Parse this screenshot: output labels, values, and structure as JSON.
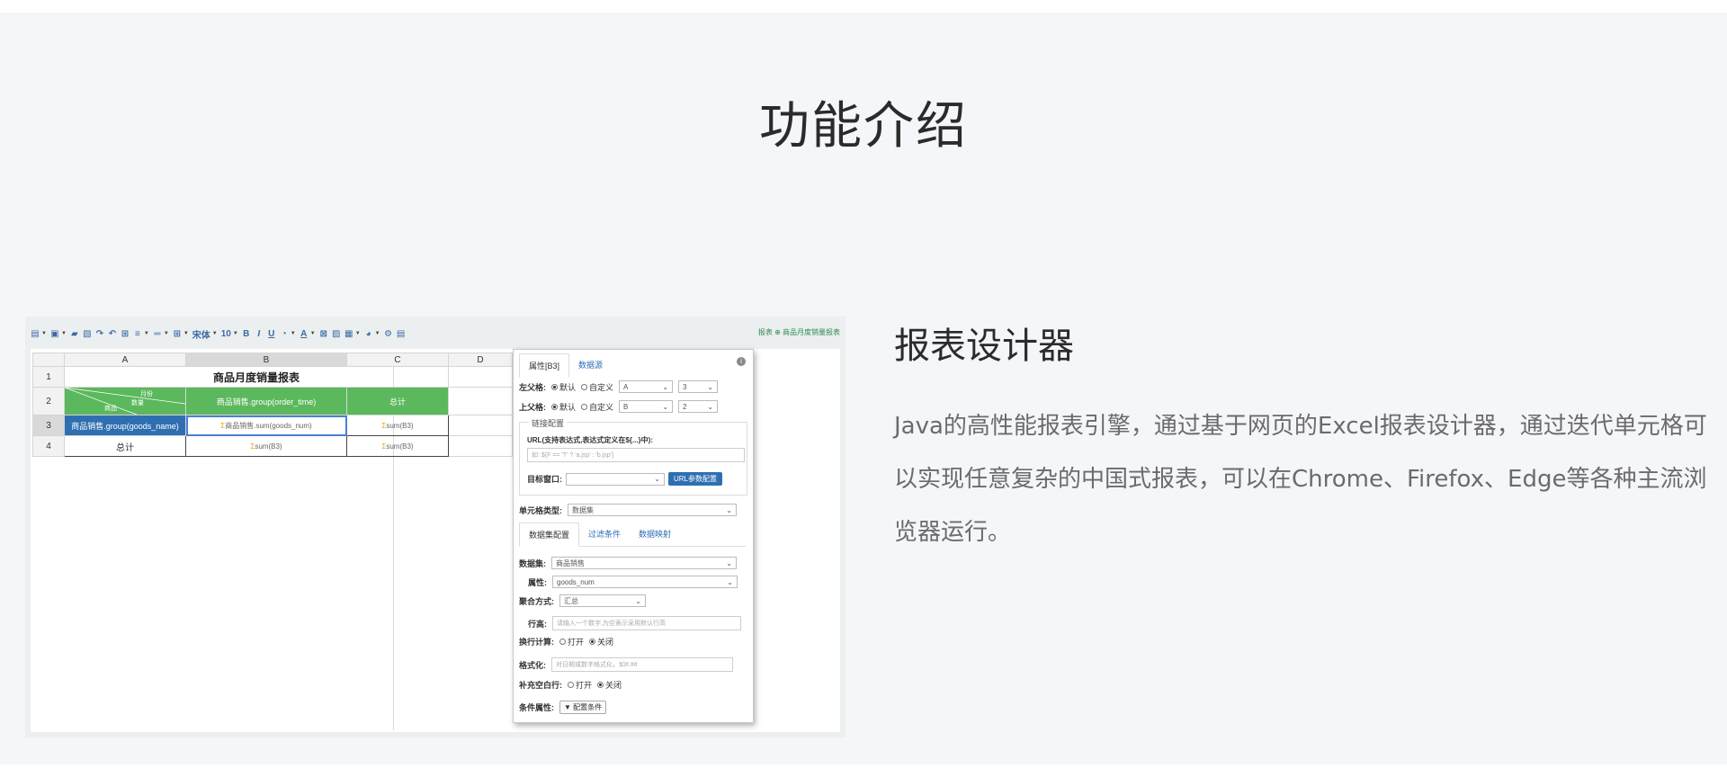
{
  "section_title": "功能介绍",
  "feature": {
    "title": "报表设计器",
    "description": "Java的高性能报表引擎，通过基于网页的Excel报表设计器，通过迭代单元格可以实现任意复杂的中国式报表，可以在Chrome、Firefox、Edge等各种主流浏览器运行。"
  },
  "designer": {
    "toolbar": {
      "font_name": "宋体",
      "font_size": "10",
      "bold": "B",
      "italic": "I",
      "underline": "U",
      "font_color": "A",
      "breadcrumb": "报表 ⊕ 商品月度销量报表"
    },
    "columns": [
      "A",
      "B",
      "C",
      "D"
    ],
    "rows": [
      "1",
      "2",
      "3",
      "4"
    ],
    "cells": {
      "title": "商品月度销量报表",
      "diag_top": "月份",
      "diag_mid": "数量",
      "diag_bottom": "商品",
      "b2": "商品销售.group(order_time)",
      "c2": "总计",
      "a3": "商品销售.group(goods_name)",
      "b3": "商品销售.sum(goods_num)",
      "c3": "sum(B3)",
      "a4": "总计",
      "b4": "sum(B3)",
      "c4": "sum(B3)",
      "tag": "Σ"
    },
    "panel": {
      "tab_props": "属性[B3]",
      "tab_datasource": "数据源",
      "info": "i",
      "left_parent_label": "左父格:",
      "top_parent_label": "上父格:",
      "opt_default": "默认",
      "opt_custom": "自定义",
      "left_parent_col": "A",
      "left_parent_row": "3",
      "top_parent_col": "B",
      "top_parent_row": "2",
      "link_legend": "链接配置",
      "url_label": "URL(支持表达式,表达式定义在${...}中):",
      "url_placeholder": "如: ${F == 'T' ? 'a.jsp' : 'b.jsp'}",
      "target_label": "目标窗口:",
      "url_param_button": "URL参数配置",
      "cell_type_label": "单元格类型:",
      "cell_type_value": "数据集",
      "subtab_dataset": "数据集配置",
      "subtab_filter": "过滤条件",
      "subtab_mapping": "数据映射",
      "dataset_label": "数据集:",
      "dataset_value": "商品销售",
      "attr_label": "属性:",
      "attr_value": "goods_num",
      "agg_label": "聚合方式:",
      "agg_value": "汇总",
      "row_height_label": "行高:",
      "row_height_placeholder": "请输入一个数字,为空表示采用默认行高",
      "wrap_calc_label": "换行计算:",
      "opt_on": "打开",
      "opt_off": "关闭",
      "format_label": "格式化:",
      "format_placeholder": "对日期或数字格式化，如#.##",
      "fill_blank_label": "补充空白行:",
      "cond_attr_label": "条件属性:",
      "cond_button": "配置条件"
    }
  }
}
